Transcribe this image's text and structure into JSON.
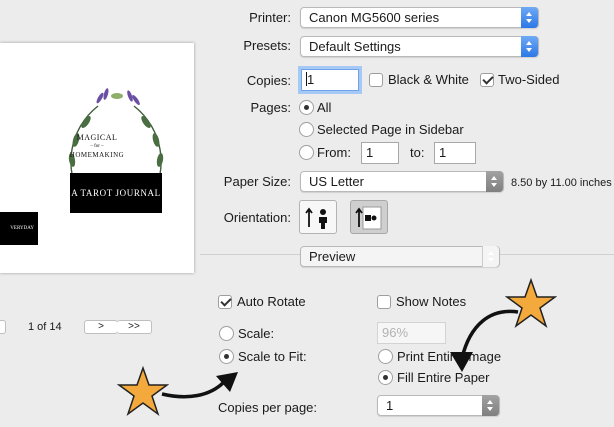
{
  "printer": {
    "label": "Printer:",
    "value": "Canon MG5600 series"
  },
  "presets": {
    "label": "Presets:",
    "value": "Default Settings"
  },
  "copies": {
    "label": "Copies:",
    "value": "1",
    "black_white_label": "Black & White",
    "black_white_checked": false,
    "two_sided_label": "Two-Sided",
    "two_sided_checked": true
  },
  "pages": {
    "label": "Pages:",
    "all_label": "All",
    "selected_label": "Selected Page in Sidebar",
    "from_label": "From:",
    "from_value": "1",
    "to_label": "to:",
    "to_value": "1"
  },
  "paper_size": {
    "label": "Paper Size:",
    "value": "US Letter",
    "dimensions": "8.50 by 11.00 inches"
  },
  "orientation": {
    "label": "Orientation:"
  },
  "section_popup": {
    "value": "Preview"
  },
  "preview_nav": {
    "page_indicator": "1 of 14",
    "next": ">",
    "last": ">>"
  },
  "preview_doc": {
    "line1": "MAGICAL",
    "line2": "– for –",
    "line3": "HOMEMAKING",
    "title": "A TAROT JOURNAL",
    "edge_text": "VERYDAY"
  },
  "options": {
    "auto_rotate_label": "Auto Rotate",
    "auto_rotate_checked": true,
    "show_notes_label": "Show Notes",
    "show_notes_checked": false,
    "scale_label": "Scale:",
    "scale_value": "96%",
    "scale_to_fit_label": "Scale to Fit:",
    "print_entire_image_label": "Print Entire Image",
    "fill_entire_paper_label": "Fill Entire Paper",
    "copies_per_page_label": "Copies per page:",
    "copies_per_page_value": "1"
  },
  "colors": {
    "accent": "#2c78e6",
    "star": "#f3a93b",
    "focus_ring": "#a6c8f4"
  }
}
